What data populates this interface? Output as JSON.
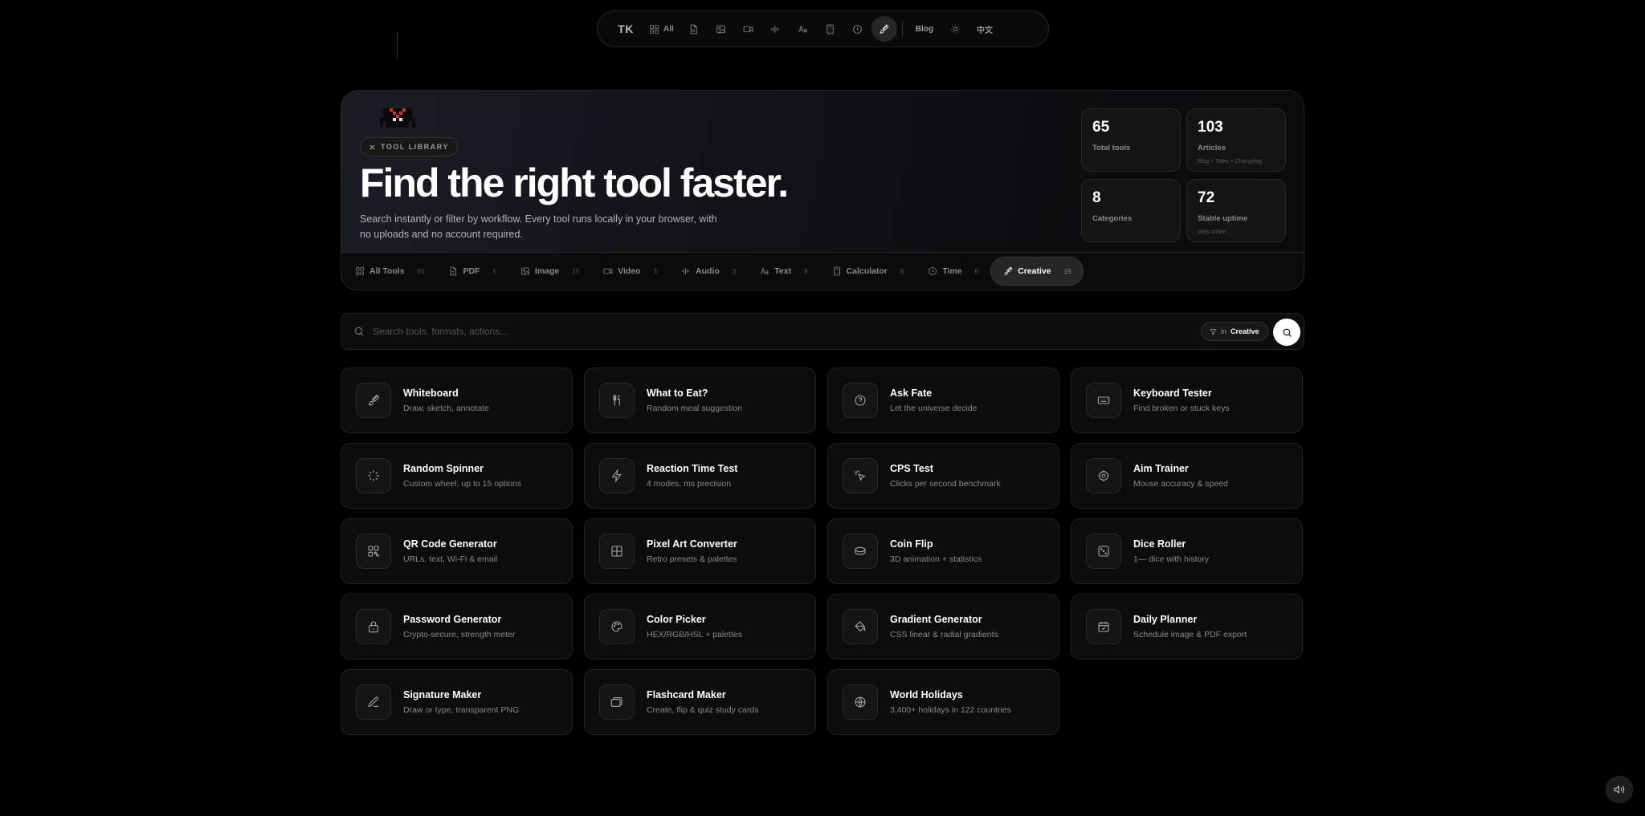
{
  "nav": {
    "logo": "TK",
    "all_label": "All",
    "blog_label": "Blog",
    "lang_label": "中文",
    "items": [
      {
        "icon": "pdf-icon"
      },
      {
        "icon": "image-icon"
      },
      {
        "icon": "video-icon"
      },
      {
        "icon": "audio-icon"
      },
      {
        "icon": "text-icon"
      },
      {
        "icon": "calculator-icon"
      },
      {
        "icon": "clock-icon"
      },
      {
        "icon": "brush-icon"
      }
    ]
  },
  "hero": {
    "badge": "TOOL LIBRARY",
    "title": "Find the right tool faster.",
    "description": "Search instantly or filter by workflow. Every tool runs locally in your browser, with no uploads and no account required.",
    "stats": [
      {
        "value": "65",
        "label": "Total tools",
        "sub": ""
      },
      {
        "value": "103",
        "label": "Articles",
        "sub": "Blog + Tales + Changelog"
      },
      {
        "value": "8",
        "label": "Categories",
        "sub": ""
      },
      {
        "value": "72",
        "label": "Stable uptime",
        "sub": "days online"
      }
    ]
  },
  "tabs": [
    {
      "label": "All Tools",
      "count": "65",
      "icon": "grid-icon"
    },
    {
      "label": "PDF",
      "count": "5",
      "icon": "pdf-icon"
    },
    {
      "label": "Image",
      "count": "15",
      "icon": "image-icon"
    },
    {
      "label": "Video",
      "count": "3",
      "icon": "video-icon"
    },
    {
      "label": "Audio",
      "count": "3",
      "icon": "audio-icon"
    },
    {
      "label": "Text",
      "count": "8",
      "icon": "text-icon"
    },
    {
      "label": "Calculator",
      "count": "6",
      "icon": "calculator-icon"
    },
    {
      "label": "Time",
      "count": "6",
      "icon": "clock-icon"
    },
    {
      "label": "Creative",
      "count": "19",
      "icon": "brush-icon",
      "active": true
    }
  ],
  "search": {
    "placeholder": "Search tools, formats, actions...",
    "filter_prefix": "in",
    "filter_value": "Creative"
  },
  "tools": [
    {
      "title": "Whiteboard",
      "desc": "Draw, sketch, annotate",
      "icon": "brush-icon"
    },
    {
      "title": "What to Eat?",
      "desc": "Random meal suggestion",
      "icon": "utensils-icon"
    },
    {
      "title": "Ask Fate",
      "desc": "Let the universe decide",
      "icon": "question-icon"
    },
    {
      "title": "Keyboard Tester",
      "desc": "Find broken or stuck keys",
      "icon": "keyboard-icon"
    },
    {
      "title": "Random Spinner",
      "desc": "Custom wheel, up to 15 options",
      "icon": "spinner-icon"
    },
    {
      "title": "Reaction Time Test",
      "desc": "4 modes, ms precision",
      "icon": "bolt-icon"
    },
    {
      "title": "CPS Test",
      "desc": "Clicks per second benchmark",
      "icon": "pointer-icon"
    },
    {
      "title": "Aim Trainer",
      "desc": "Mouse accuracy & speed",
      "icon": "target-icon"
    },
    {
      "title": "QR Code Generator",
      "desc": "URLs, text, Wi-Fi & email",
      "icon": "qr-icon"
    },
    {
      "title": "Pixel Art Converter",
      "desc": "Retro presets & palettes",
      "icon": "pixel-grid-icon"
    },
    {
      "title": "Coin Flip",
      "desc": "3D animation + statistics",
      "icon": "coin-icon"
    },
    {
      "title": "Dice Roller",
      "desc": "1— dice with history",
      "icon": "dice-icon"
    },
    {
      "title": "Password Generator",
      "desc": "Crypto-secure, strength meter",
      "icon": "lock-icon"
    },
    {
      "title": "Color Picker",
      "desc": "HEX/RGB/HSL + palettes",
      "icon": "palette-icon"
    },
    {
      "title": "Gradient Generator",
      "desc": "CSS linear & radial gradients",
      "icon": "paint-bucket-icon"
    },
    {
      "title": "Daily Planner",
      "desc": "Schedule image & PDF export",
      "icon": "calendar-icon"
    },
    {
      "title": "Signature Maker",
      "desc": "Draw or type, transparent PNG",
      "icon": "pen-icon"
    },
    {
      "title": "Flashcard Maker",
      "desc": "Create, flip & quiz study cards",
      "icon": "cards-icon"
    },
    {
      "title": "World Holidays",
      "desc": "3,400+ holidays in 122 countries",
      "icon": "globe-icon"
    }
  ],
  "colors": {
    "background": "#000000",
    "card": "#0c0c0c",
    "border": "#232323",
    "muted_text": "#8a8a8a",
    "mascot_red": "#d93030"
  }
}
